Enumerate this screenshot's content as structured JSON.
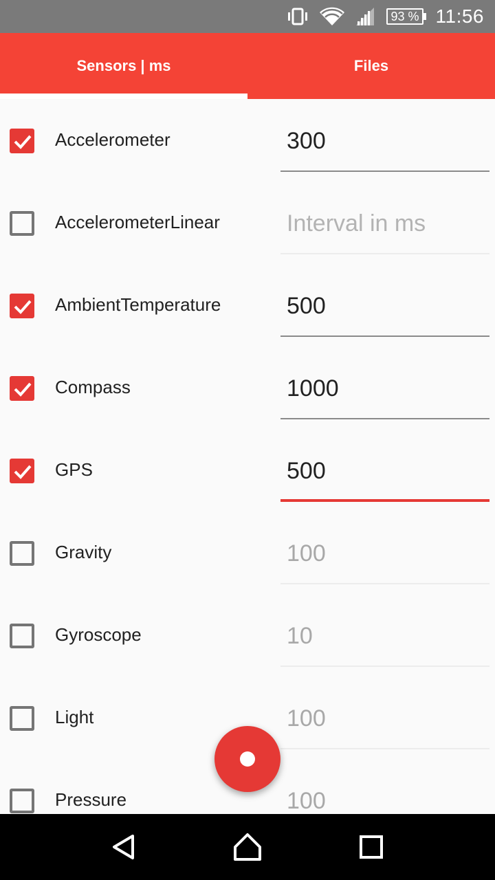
{
  "status_bar": {
    "battery_level": "93 %",
    "time": "11:56",
    "icons": [
      "vibrate-icon",
      "wifi-icon",
      "cell-signal-icon",
      "battery-icon"
    ]
  },
  "tabs": [
    {
      "label": "Sensors | ms",
      "active": true
    },
    {
      "label": "Files",
      "active": false
    }
  ],
  "sensors": [
    {
      "name": "Accelerometer",
      "checked": true,
      "interval": "300",
      "placeholder": "Interval in ms"
    },
    {
      "name": "AccelerometerLinear",
      "checked": false,
      "interval": "",
      "placeholder": "Interval in ms"
    },
    {
      "name": "AmbientTemperature",
      "checked": true,
      "interval": "500",
      "placeholder": "Interval in ms"
    },
    {
      "name": "Compass",
      "checked": true,
      "interval": "1000",
      "placeholder": "Interval in ms"
    },
    {
      "name": "GPS",
      "checked": true,
      "interval": "500",
      "placeholder": "Interval in ms",
      "focused": true
    },
    {
      "name": "Gravity",
      "checked": false,
      "interval": "100",
      "placeholder": "Interval in ms"
    },
    {
      "name": "Gyroscope",
      "checked": false,
      "interval": "10",
      "placeholder": "Interval in ms"
    },
    {
      "name": "Light",
      "checked": false,
      "interval": "100",
      "placeholder": "Interval in ms"
    },
    {
      "name": "Pressure",
      "checked": false,
      "interval": "100",
      "placeholder": "Interval in ms"
    }
  ],
  "fab": {
    "icon": "record-icon"
  },
  "nav_bar": {
    "icons": [
      "back-icon",
      "home-icon",
      "recents-icon"
    ]
  },
  "colors": {
    "accent": "#f44336",
    "checkbox_checked": "#e53935",
    "status_bar": "#7a7a7a"
  }
}
